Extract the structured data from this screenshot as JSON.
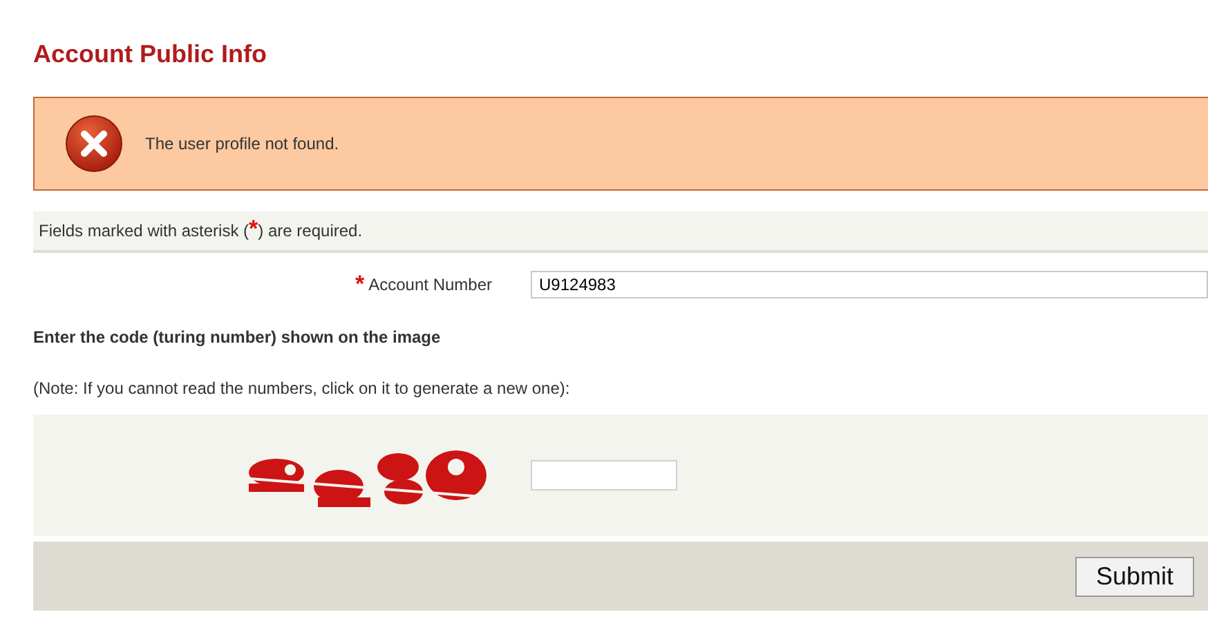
{
  "title": "Account Public Info",
  "error": {
    "message": "The user profile not found."
  },
  "required_note": {
    "before": "Fields marked with asterisk (",
    "mark": "*",
    "after": ") are required."
  },
  "account_field": {
    "required_mark": "*",
    "label": "Account Number",
    "value": "U9124983"
  },
  "captcha": {
    "heading": "Enter the code (turing number) shown on the image",
    "note": "(Note: If you cannot read the numbers, click on it to generate a new one):"
  },
  "buttons": [
    {
      "label": "Submit"
    }
  ]
}
